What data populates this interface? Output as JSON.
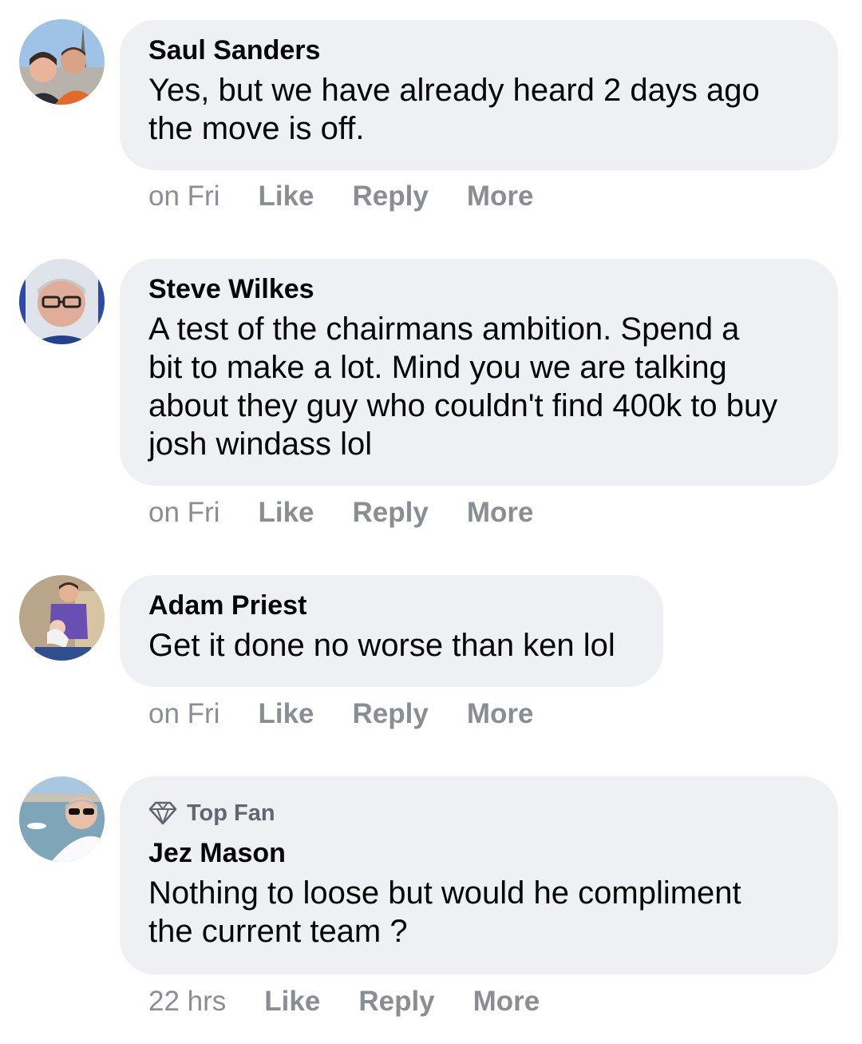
{
  "comments": [
    {
      "author": "Saul Sanders",
      "text_lines": [
        "Yes, but we have already heard 2 days ago",
        "the move is off."
      ],
      "time": "on Fri",
      "like": "Like",
      "reply": "Reply",
      "more": "More",
      "avatar_icon": "couple-photo-avatar"
    },
    {
      "author": "Steve Wilkes",
      "text_lines": [
        "A test of the chairmans ambition. Spend a",
        "bit to make a lot. Mind you we are talking",
        "about they guy who couldn't find 400k to buy",
        "josh windass lol"
      ],
      "time": "on Fri",
      "like": "Like",
      "reply": "Reply",
      "more": "More",
      "avatar_icon": "man-glasses-avatar"
    },
    {
      "author": "Adam Priest",
      "text_lines": [
        "Get it done no worse than ken lol"
      ],
      "time": "on Fri",
      "like": "Like",
      "reply": "Reply",
      "more": "More",
      "avatar_icon": "man-with-baby-avatar"
    },
    {
      "badge": "Top Fan",
      "badge_icon": "diamond-icon",
      "author": "Jez Mason",
      "text_lines": [
        "Nothing to loose but would he compliment",
        "the current team ?"
      ],
      "time": "22 hrs",
      "like": "Like",
      "reply": "Reply",
      "more": "More",
      "avatar_icon": "man-sunglasses-harbour-avatar"
    }
  ],
  "colors": {
    "bubble": "#eff0f4",
    "text": "#050505",
    "meta": "#8a8d91",
    "badge": "#606770"
  }
}
